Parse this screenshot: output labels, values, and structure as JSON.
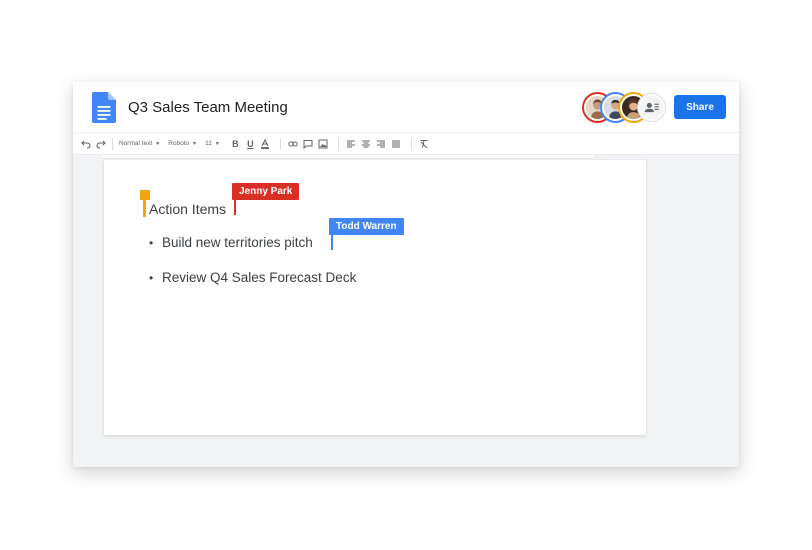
{
  "document": {
    "title": "Q3 Sales Team Meeting"
  },
  "header": {
    "share_label": "Share"
  },
  "toolbar": {
    "style_value": "Normal text",
    "font_value": "Roboto",
    "size_value": "11"
  },
  "content": {
    "heading": "Action Items",
    "bullets": [
      "Build new territories pitch",
      "Review Q4 Sales Forecast Deck"
    ]
  },
  "collaborators": [
    {
      "name": "Jenny Park",
      "color": "#d93025"
    },
    {
      "name": "Todd Warren",
      "color": "#4285f4"
    }
  ],
  "colors": {
    "accent": "#1a73e8",
    "jenny": "#d93025",
    "todd": "#4285f4",
    "third_cursor": "#f2a60c"
  }
}
